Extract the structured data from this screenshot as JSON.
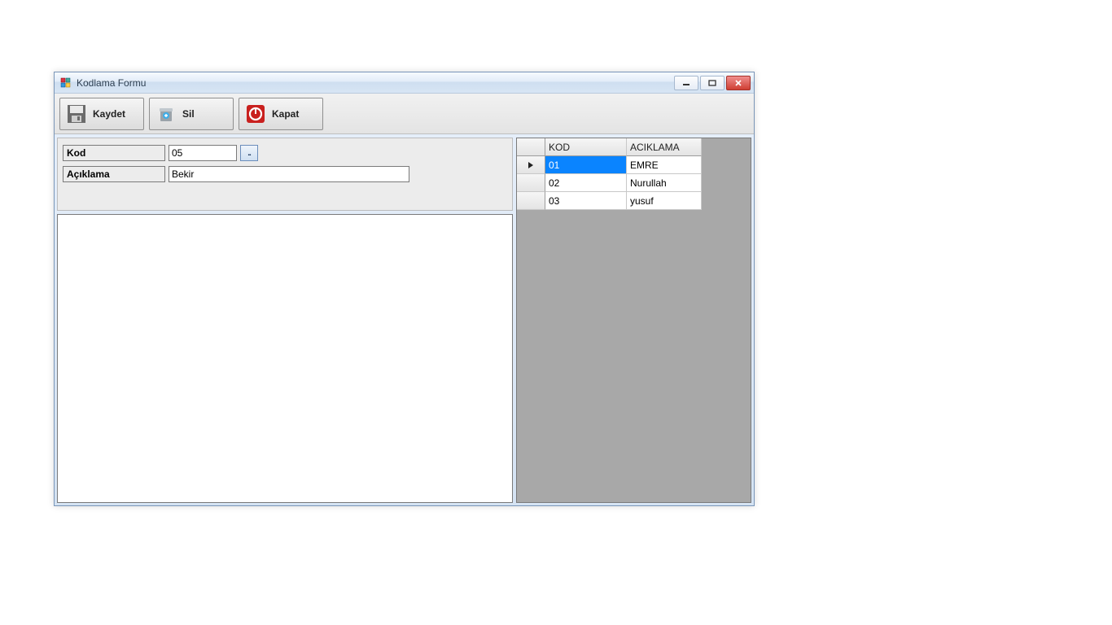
{
  "window": {
    "title": "Kodlama Formu"
  },
  "toolbar": {
    "save_label": "Kaydet",
    "delete_label": "Sil",
    "close_label": "Kapat"
  },
  "form": {
    "kod_label": "Kod",
    "kod_value": "05",
    "lookup_label": "..",
    "aciklama_label": "Açıklama",
    "aciklama_value": "Bekir"
  },
  "grid": {
    "col_kod": "KOD",
    "col_aciklama": "ACIKLAMA",
    "rows": [
      {
        "kod": "01",
        "aciklama": "EMRE",
        "selected": true
      },
      {
        "kod": "02",
        "aciklama": "Nurullah",
        "selected": false
      },
      {
        "kod": "03",
        "aciklama": "yusuf",
        "selected": false
      }
    ]
  }
}
